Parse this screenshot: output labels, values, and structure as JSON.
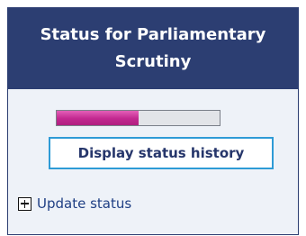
{
  "panel": {
    "title": "Status for Parliamentary Scrutiny",
    "header_bg": "#2c3e72",
    "body_bg": "#eef2f8"
  },
  "progress": {
    "fraction": 0.5,
    "fill_color": "#c2288f"
  },
  "history_button": {
    "label": "Display status history",
    "border_color": "#2e9bd6"
  },
  "update_link": {
    "label": "Update status",
    "icon": "plus-box-icon"
  }
}
